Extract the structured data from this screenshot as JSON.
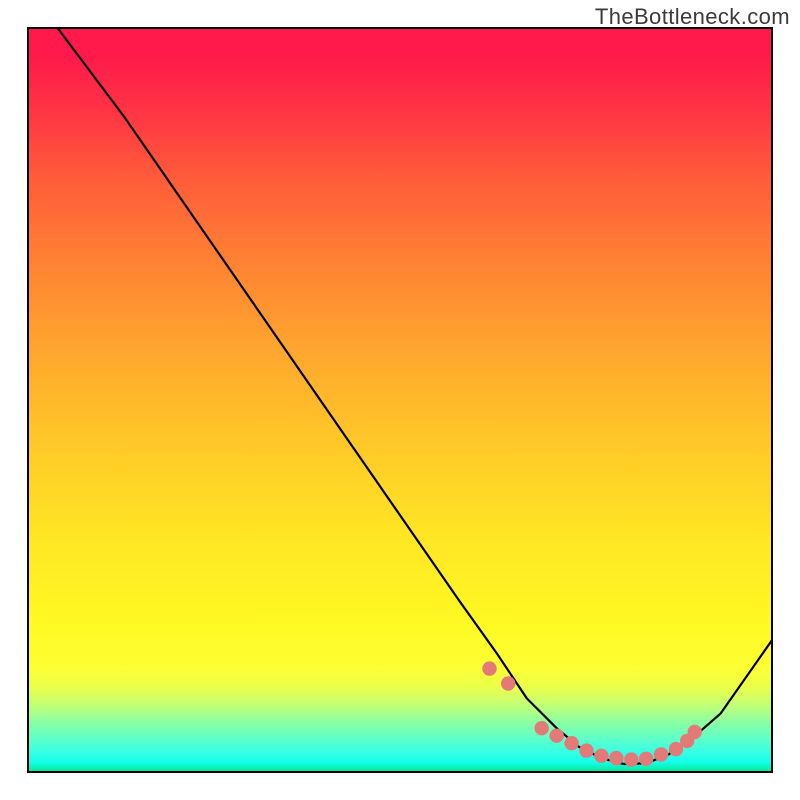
{
  "watermark": "TheBottleneck.com",
  "chart_data": {
    "type": "line",
    "title": "",
    "xlabel": "",
    "ylabel": "",
    "xlim": [
      0,
      100
    ],
    "ylim": [
      0,
      100
    ],
    "grid": false,
    "legend": false,
    "description": "Single black curve over a vertical red→yellow→green gradient; the curve descends from top-left, reaches a minimum near x≈80, then rises toward the right edge. Salmon-colored dots are clustered along the bottom of the valley.",
    "series": [
      {
        "name": "curve",
        "x": [
          4,
          13,
          22,
          31,
          40,
          49,
          58,
          63,
          67,
          71,
          74,
          77,
          80,
          83,
          86,
          89,
          93,
          100
        ],
        "values": [
          100,
          88,
          75,
          62,
          49,
          36,
          23,
          16,
          10,
          6,
          3.5,
          2,
          1.2,
          1.3,
          2.5,
          4.5,
          8,
          18
        ]
      }
    ],
    "dots": {
      "x": [
        62,
        64.5,
        69,
        71,
        73,
        75,
        77,
        79,
        81,
        83,
        85,
        87,
        88.5,
        89.5
      ],
      "y": [
        14,
        12,
        6,
        5,
        4,
        3,
        2.3,
        2,
        1.8,
        1.9,
        2.5,
        3.2,
        4.3,
        5.5
      ]
    },
    "gradient_stops": [
      {
        "pos": 0,
        "color": "#ff1a4b"
      },
      {
        "pos": 50,
        "color": "#ffc628"
      },
      {
        "pos": 80,
        "color": "#fff923"
      },
      {
        "pos": 100,
        "color": "#00e58a"
      }
    ]
  }
}
